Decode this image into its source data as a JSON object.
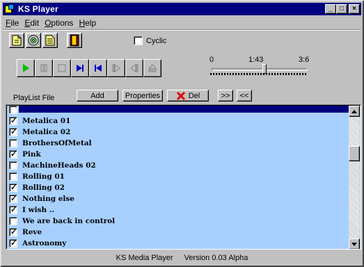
{
  "window": {
    "title": "KS Player"
  },
  "titlebar_buttons": {
    "minimize": "_",
    "maximize": "□",
    "close": "×"
  },
  "menu": [
    "File",
    "Edit",
    "Options",
    "Help"
  ],
  "menu_underline": [
    "F",
    "E",
    "O",
    "H"
  ],
  "toolbar": {
    "icons": [
      "new-file-icon",
      "cd-icon",
      "notes-icon",
      "exit-door-icon"
    ],
    "cyclic_label": "Cyclic",
    "cyclic_checked": false
  },
  "transport": {
    "buttons": [
      "play-icon",
      "pause-icon",
      "stop-icon",
      "next-icon",
      "previous-icon",
      "step-forward-icon",
      "step-back-icon",
      "eject-icon"
    ],
    "time_start": "0",
    "time_current": "1:43",
    "time_end": "3:6",
    "position": 0.55
  },
  "playlist": {
    "label": "PlayList File",
    "add_label": "Add",
    "properties_label": "Properties",
    "del_label": "Del",
    "forward_label": ">>",
    "back_label": "<<",
    "items": [
      {
        "label": "",
        "checked": false,
        "selected": true
      },
      {
        "label": "Metalica 01",
        "checked": true
      },
      {
        "label": "Metalica 02",
        "checked": true
      },
      {
        "label": "BrothersOfMetal",
        "checked": false
      },
      {
        "label": "Pink",
        "checked": true
      },
      {
        "label": "MachineHeads 02",
        "checked": false
      },
      {
        "label": "Rolling 01",
        "checked": false
      },
      {
        "label": "Rolling 02",
        "checked": true
      },
      {
        "label": "Nothing else",
        "checked": true
      },
      {
        "label": "I wish ..",
        "checked": true
      },
      {
        "label": "We are back in control",
        "checked": false
      },
      {
        "label": "Reve",
        "checked": true
      },
      {
        "label": "Astronomy",
        "checked": true
      }
    ]
  },
  "status": {
    "app": "KS Media Player",
    "version": "Version 0.03 Alpha"
  },
  "colors": {
    "selection": "#000080",
    "list_bg": "#a8d0ff",
    "titlebar": "#000080"
  }
}
